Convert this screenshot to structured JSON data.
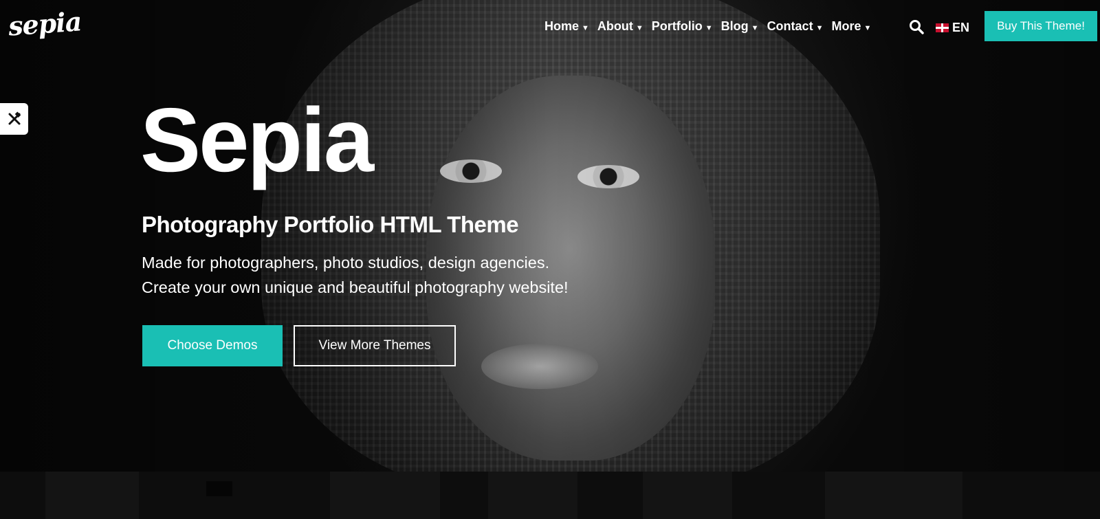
{
  "colors": {
    "accent": "#1abfb4",
    "text": "#ffffff",
    "background": "#0b0b0b"
  },
  "header": {
    "logo": "sepia",
    "nav": [
      {
        "label": "Home",
        "icon": "chevron-down-icon"
      },
      {
        "label": "About",
        "icon": "chevron-down-icon"
      },
      {
        "label": "Portfolio",
        "icon": "chevron-down-icon"
      },
      {
        "label": "Blog",
        "icon": "chevron-down-icon"
      },
      {
        "label": "Contact",
        "icon": "chevron-down-icon"
      },
      {
        "label": "More",
        "icon": "chevron-down-icon"
      }
    ],
    "search_icon": "search-icon",
    "language": "EN",
    "language_flag": "uk-flag-icon",
    "buy_label": "Buy This Theme!"
  },
  "sidebar_tool_icon": "tools-icon",
  "hero": {
    "title": "Sepia",
    "subtitle": "Photography Portfolio HTML Theme",
    "description_line1": "Made for photographers, photo studios, design agencies.",
    "description_line2": "Create your own unique and beautiful photography website!",
    "primary_button": "Choose Demos",
    "secondary_button": "View More Themes"
  }
}
